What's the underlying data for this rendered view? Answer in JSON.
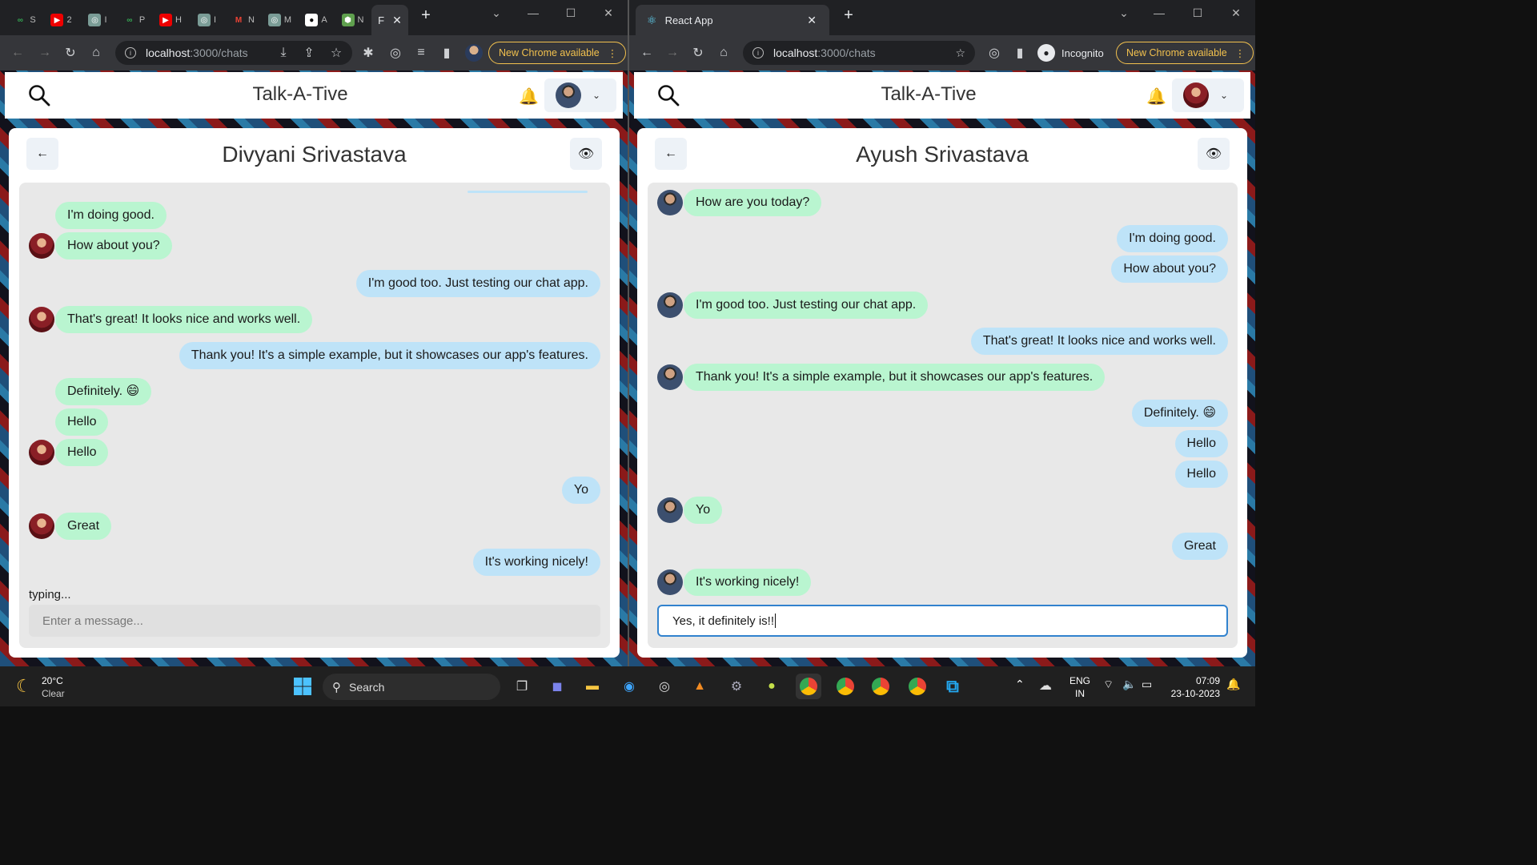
{
  "left": {
    "url_host": "localhost",
    "url_path": ":3000/chats",
    "new_chrome": "New Chrome available",
    "pinned_tabs": [
      "S",
      "2",
      "I",
      "P",
      "H",
      "I",
      "N",
      "M",
      "A",
      "N",
      "F"
    ],
    "brand": "Talk-A-Tive",
    "chat_title": "Divyani Srivastava",
    "typing": "typing...",
    "input_placeholder": "Enter a message...",
    "messages": [
      {
        "text": "I'm doing good.",
        "side": "in",
        "avatar": false
      },
      {
        "text": "How about you?",
        "side": "in",
        "avatar": true
      },
      {
        "text": "I'm good too. Just testing our chat app.",
        "side": "out",
        "avatar": false
      },
      {
        "text": "That's great! It looks nice and works well.",
        "side": "in",
        "avatar": true
      },
      {
        "text": "Thank you! It's a simple example, but it showcases our app's features.",
        "side": "out",
        "avatar": false
      },
      {
        "text": "Definitely. 😄",
        "side": "in",
        "avatar": false
      },
      {
        "text": "Hello",
        "side": "in",
        "avatar": false
      },
      {
        "text": "Hello",
        "side": "in",
        "avatar": true
      },
      {
        "text": "Yo",
        "side": "out",
        "avatar": false
      },
      {
        "text": "Great",
        "side": "in",
        "avatar": true
      },
      {
        "text": "It's working nicely!",
        "side": "out",
        "avatar": false
      }
    ]
  },
  "right": {
    "tab_title": "React App",
    "url_host": "localhost",
    "url_path": ":3000/chats",
    "incognito": "Incognito",
    "new_chrome": "New Chrome available",
    "brand": "Talk-A-Tive",
    "chat_title": "Ayush Srivastava",
    "input_value": "Yes, it definitely is!!",
    "messages": [
      {
        "text": "How are you today?",
        "side": "in",
        "avatar": true
      },
      {
        "text": "I'm doing good.",
        "side": "out",
        "avatar": false
      },
      {
        "text": "How about you?",
        "side": "out",
        "avatar": false
      },
      {
        "text": "I'm good too. Just testing our chat app.",
        "side": "in",
        "avatar": true
      },
      {
        "text": "That's great! It looks nice and works well.",
        "side": "out",
        "avatar": false
      },
      {
        "text": "Thank you! It's a simple example, but it showcases our app's features.",
        "side": "in",
        "avatar": true
      },
      {
        "text": "Definitely. 😄",
        "side": "out",
        "avatar": false
      },
      {
        "text": "Hello",
        "side": "out",
        "avatar": false
      },
      {
        "text": "Hello",
        "side": "out",
        "avatar": false
      },
      {
        "text": "Yo",
        "side": "in",
        "avatar": true
      },
      {
        "text": "Great",
        "side": "out",
        "avatar": false
      },
      {
        "text": "It's working nicely!",
        "side": "in",
        "avatar": true
      }
    ]
  },
  "taskbar": {
    "temperature": "20°C",
    "weather": "Clear",
    "search": "Search",
    "lang1": "ENG",
    "lang2": "IN",
    "time": "07:09",
    "date": "23-10-2023"
  },
  "colors": {
    "incoming": "#b9f5d0",
    "outgoing": "#bee3f8",
    "accent": "#3182ce",
    "chrome_update": "#f2c14e"
  }
}
